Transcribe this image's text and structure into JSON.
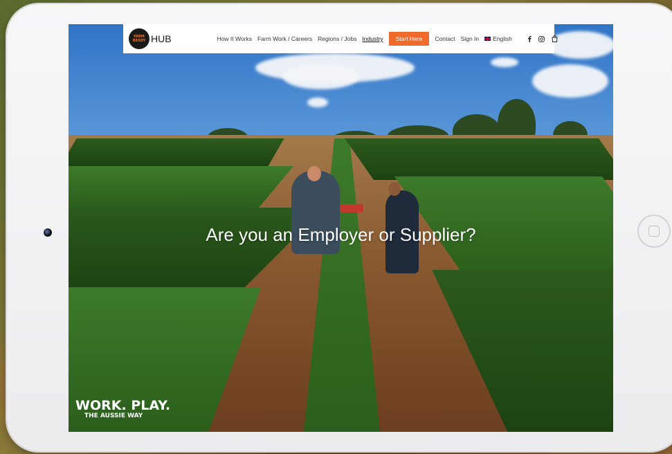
{
  "navbar": {
    "logo_mark": "FARM READY",
    "logo_text": "HUB",
    "links": [
      "How It Works",
      "Farm Work / Careers",
      "Regions / Jobs",
      "Industry"
    ],
    "cta": "Start Here",
    "contact": "Contact",
    "sign_in": "Sign In",
    "language": "English"
  },
  "hero": {
    "title": "Are you an Employer or Supplier?"
  },
  "badge": {
    "line1": "WORK. PLAY.",
    "line2": "THE AUSSIE WAY"
  },
  "icons": {
    "facebook": "facebook-icon",
    "instagram": "instagram-icon",
    "cart": "shopping-bag-icon",
    "flag": "uk-flag-icon"
  },
  "colors": {
    "accent": "#ef6a2b",
    "navbar_bg": "#ffffff"
  }
}
